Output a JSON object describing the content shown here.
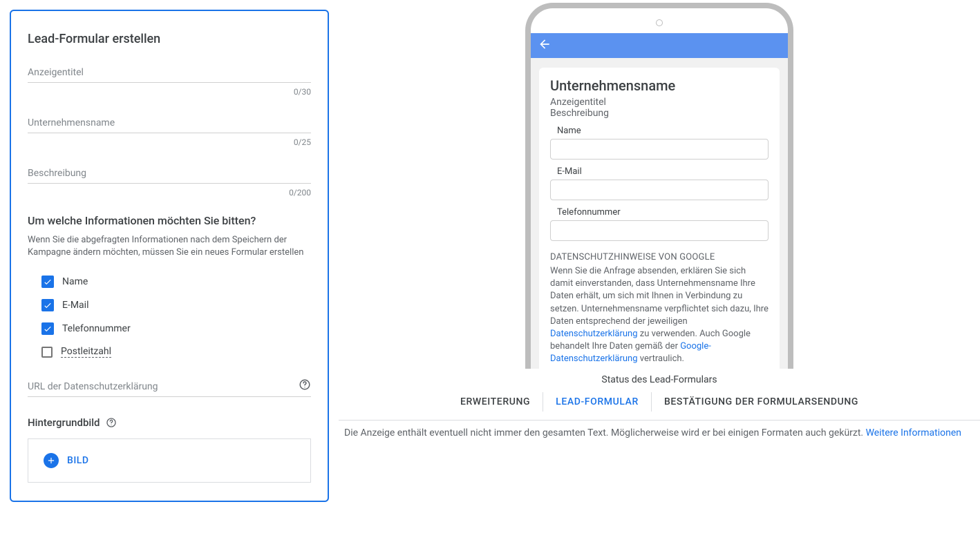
{
  "editor": {
    "title": "Lead-Formular erstellen",
    "fields": {
      "anzeigentitel": {
        "label": "Anzeigentitel",
        "counter": "0/30"
      },
      "unternehmensname": {
        "label": "Unternehmensname",
        "counter": "0/25"
      },
      "beschreibung": {
        "label": "Beschreibung",
        "counter": "0/200"
      },
      "privacy_url": {
        "label": "URL der Datenschutzerklärung"
      }
    },
    "info_section": {
      "heading": "Um welche Informationen möchten Sie bitten?",
      "subtext": "Wenn Sie die abgefragten Informationen nach dem Speichern der Kampagne ändern möchten, müssen Sie ein neues Formular erstellen",
      "items": [
        {
          "label": "Name",
          "checked": true
        },
        {
          "label": "E-Mail",
          "checked": true
        },
        {
          "label": "Telefonnummer",
          "checked": true
        },
        {
          "label": "Postleitzahl",
          "checked": false
        }
      ]
    },
    "background": {
      "heading": "Hintergrundbild",
      "button": "BILD"
    }
  },
  "preview": {
    "company": "Unternehmensname",
    "anzeigentitel": "Anzeigentitel",
    "beschreibung": "Beschreibung",
    "field_name": "Name",
    "field_email": "E-Mail",
    "field_phone": "Telefonnummer",
    "privacy_title": "DATENSCHUTZHINWEISE VON GOOGLE",
    "privacy_body_1": "Wenn Sie die Anfrage absenden, erklären Sie sich damit einverstanden, dass Unternehmensname Ihre Daten erhält, um sich mit Ihnen in Verbindung zu setzen. Unternehmensname verpflichtet sich dazu, Ihre Daten entsprechend der jeweiligen ",
    "privacy_link_1": "Datenschutzerklärung",
    "privacy_body_2": " zu verwenden. Auch Google behandelt Ihre Daten gemäß der ",
    "privacy_link_2": "Google-Datenschutzerklärung",
    "privacy_body_3": " vertraulich."
  },
  "status": {
    "label": "Status des Lead-Formulars",
    "tabs": [
      {
        "label": "ERWEITERUNG",
        "active": false
      },
      {
        "label": "LEAD-FORMULAR",
        "active": true
      },
      {
        "label": "BESTÄTIGUNG DER FORMULARSENDUNG",
        "active": false
      }
    ]
  },
  "footnote": {
    "text": "Die Anzeige enthält eventuell nicht immer den gesamten Text. Möglicherweise wird er bei einigen Formaten auch gekürzt. ",
    "link": "Weitere Informationen"
  }
}
